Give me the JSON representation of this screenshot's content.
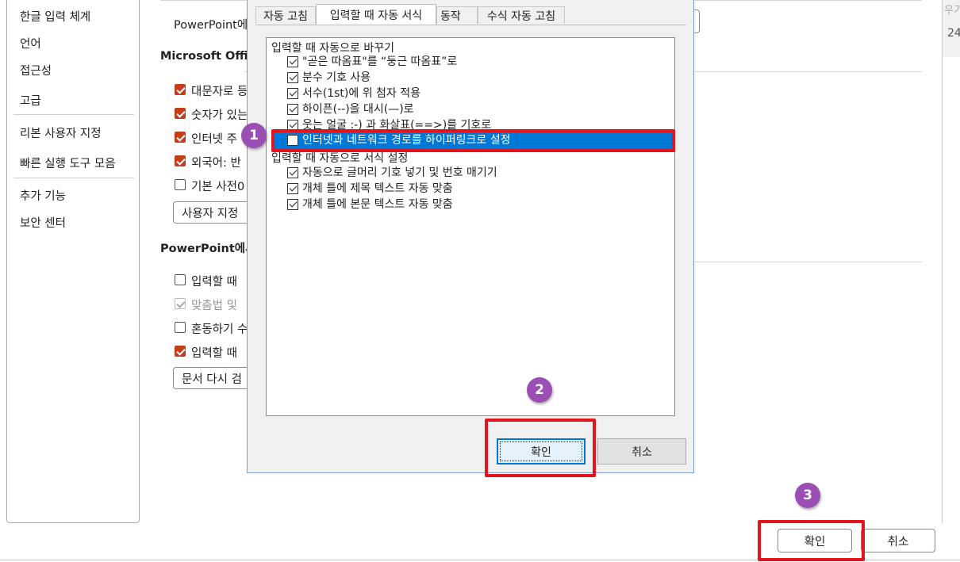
{
  "nav": {
    "items": [
      "한글 입력 체계",
      "언어",
      "접근성",
      "고급",
      "리본 사용자 지정",
      "빠른 실행 도구 모음",
      "추가 기능",
      "보안 센터"
    ]
  },
  "main": {
    "top_label": "PowerPoint에",
    "section1_title": "Microsoft Offic",
    "section1_options": [
      {
        "label": "대문자로 등",
        "checked": true
      },
      {
        "label": "숫자가 있는",
        "checked": true
      },
      {
        "label": "인터넷 주",
        "checked": true
      },
      {
        "label": "외국어: 반",
        "checked": true
      },
      {
        "label": "기본 사전0",
        "checked": false
      }
    ],
    "custom_dict_button": "사용자 지정",
    "section2_title": "PowerPoint에서",
    "section2_options": [
      {
        "label": "입력할 때",
        "checked": false,
        "disabled": false
      },
      {
        "label": "맞춤법 및",
        "checked": true,
        "disabled": true
      },
      {
        "label": "혼동하기 수",
        "checked": false,
        "disabled": false
      },
      {
        "label": "입력할 때",
        "checked": true,
        "disabled": false
      }
    ],
    "recheck_button": "문서 다시 검",
    "ok_button": "확인",
    "cancel_button": "취소"
  },
  "right_edge": {
    "label1": "우기",
    "label2": "24"
  },
  "dialog": {
    "tabs": [
      "자동 고침",
      "입력할 때 자동 서식",
      "동작",
      "수식 자동 고침"
    ],
    "active_tab": 1,
    "group1_title": "입력할 때 자동으로 바꾸기",
    "group1_items": [
      {
        "label": "\"곧은 따옴표\"를 “둥근 따옴표”로",
        "checked": true
      },
      {
        "label": "분수 기호 사용",
        "checked": true
      },
      {
        "label": "서수(1st)에 위 첨자 적용",
        "checked": true
      },
      {
        "label": "하이픈(--)을 대시(—)로",
        "checked": true
      },
      {
        "label": "웃는 얼굴 :-) 과 화살표(==>)를 기호로",
        "checked": true
      },
      {
        "label": "인터넷과 네트워크 경로를 하이퍼링크로 설정",
        "checked": false,
        "selected": true
      }
    ],
    "group2_title": "입력할 때 자동으로 서식 설정",
    "group2_items": [
      {
        "label": "자동으로 글머리 기호 넣기 및 번호 매기기",
        "checked": true
      },
      {
        "label": "개체 틀에 제목 텍스트 자동 맞춤",
        "checked": true
      },
      {
        "label": "개체 틀에 본문 텍스트 자동 맞춤",
        "checked": true
      }
    ],
    "ok_button": "확인",
    "cancel_button": "취소"
  },
  "annotations": {
    "markers": [
      "1",
      "2",
      "3"
    ],
    "highlight_color": "#e3141b",
    "marker_color": "#9b4fb4"
  },
  "colors": {
    "checkbox_accent": "#c43e1c",
    "selection": "#0078d7"
  }
}
